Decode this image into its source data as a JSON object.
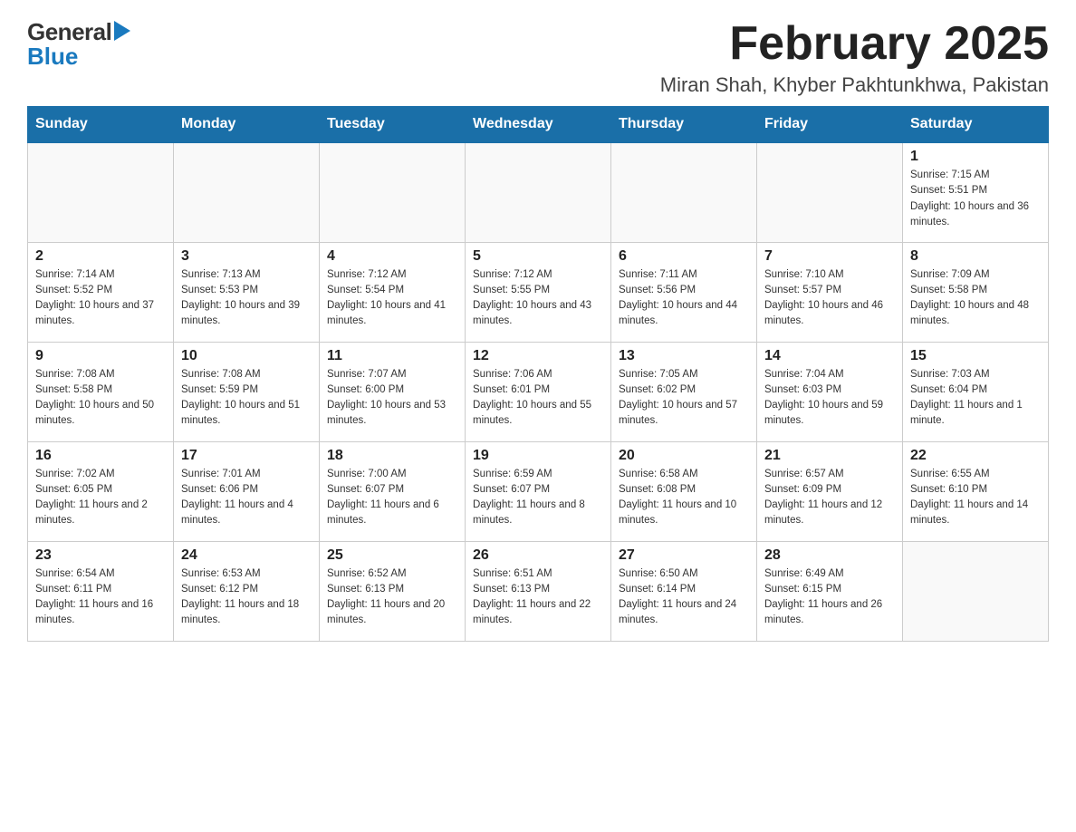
{
  "header": {
    "logo_general": "General",
    "logo_blue": "Blue",
    "month_title": "February 2025",
    "subtitle": "Miran Shah, Khyber Pakhtunkhwa, Pakistan"
  },
  "days_of_week": [
    "Sunday",
    "Monday",
    "Tuesday",
    "Wednesday",
    "Thursday",
    "Friday",
    "Saturday"
  ],
  "weeks": [
    [
      {
        "day": "",
        "sunrise": "",
        "sunset": "",
        "daylight": ""
      },
      {
        "day": "",
        "sunrise": "",
        "sunset": "",
        "daylight": ""
      },
      {
        "day": "",
        "sunrise": "",
        "sunset": "",
        "daylight": ""
      },
      {
        "day": "",
        "sunrise": "",
        "sunset": "",
        "daylight": ""
      },
      {
        "day": "",
        "sunrise": "",
        "sunset": "",
        "daylight": ""
      },
      {
        "day": "",
        "sunrise": "",
        "sunset": "",
        "daylight": ""
      },
      {
        "day": "1",
        "sunrise": "Sunrise: 7:15 AM",
        "sunset": "Sunset: 5:51 PM",
        "daylight": "Daylight: 10 hours and 36 minutes."
      }
    ],
    [
      {
        "day": "2",
        "sunrise": "Sunrise: 7:14 AM",
        "sunset": "Sunset: 5:52 PM",
        "daylight": "Daylight: 10 hours and 37 minutes."
      },
      {
        "day": "3",
        "sunrise": "Sunrise: 7:13 AM",
        "sunset": "Sunset: 5:53 PM",
        "daylight": "Daylight: 10 hours and 39 minutes."
      },
      {
        "day": "4",
        "sunrise": "Sunrise: 7:12 AM",
        "sunset": "Sunset: 5:54 PM",
        "daylight": "Daylight: 10 hours and 41 minutes."
      },
      {
        "day": "5",
        "sunrise": "Sunrise: 7:12 AM",
        "sunset": "Sunset: 5:55 PM",
        "daylight": "Daylight: 10 hours and 43 minutes."
      },
      {
        "day": "6",
        "sunrise": "Sunrise: 7:11 AM",
        "sunset": "Sunset: 5:56 PM",
        "daylight": "Daylight: 10 hours and 44 minutes."
      },
      {
        "day": "7",
        "sunrise": "Sunrise: 7:10 AM",
        "sunset": "Sunset: 5:57 PM",
        "daylight": "Daylight: 10 hours and 46 minutes."
      },
      {
        "day": "8",
        "sunrise": "Sunrise: 7:09 AM",
        "sunset": "Sunset: 5:58 PM",
        "daylight": "Daylight: 10 hours and 48 minutes."
      }
    ],
    [
      {
        "day": "9",
        "sunrise": "Sunrise: 7:08 AM",
        "sunset": "Sunset: 5:58 PM",
        "daylight": "Daylight: 10 hours and 50 minutes."
      },
      {
        "day": "10",
        "sunrise": "Sunrise: 7:08 AM",
        "sunset": "Sunset: 5:59 PM",
        "daylight": "Daylight: 10 hours and 51 minutes."
      },
      {
        "day": "11",
        "sunrise": "Sunrise: 7:07 AM",
        "sunset": "Sunset: 6:00 PM",
        "daylight": "Daylight: 10 hours and 53 minutes."
      },
      {
        "day": "12",
        "sunrise": "Sunrise: 7:06 AM",
        "sunset": "Sunset: 6:01 PM",
        "daylight": "Daylight: 10 hours and 55 minutes."
      },
      {
        "day": "13",
        "sunrise": "Sunrise: 7:05 AM",
        "sunset": "Sunset: 6:02 PM",
        "daylight": "Daylight: 10 hours and 57 minutes."
      },
      {
        "day": "14",
        "sunrise": "Sunrise: 7:04 AM",
        "sunset": "Sunset: 6:03 PM",
        "daylight": "Daylight: 10 hours and 59 minutes."
      },
      {
        "day": "15",
        "sunrise": "Sunrise: 7:03 AM",
        "sunset": "Sunset: 6:04 PM",
        "daylight": "Daylight: 11 hours and 1 minute."
      }
    ],
    [
      {
        "day": "16",
        "sunrise": "Sunrise: 7:02 AM",
        "sunset": "Sunset: 6:05 PM",
        "daylight": "Daylight: 11 hours and 2 minutes."
      },
      {
        "day": "17",
        "sunrise": "Sunrise: 7:01 AM",
        "sunset": "Sunset: 6:06 PM",
        "daylight": "Daylight: 11 hours and 4 minutes."
      },
      {
        "day": "18",
        "sunrise": "Sunrise: 7:00 AM",
        "sunset": "Sunset: 6:07 PM",
        "daylight": "Daylight: 11 hours and 6 minutes."
      },
      {
        "day": "19",
        "sunrise": "Sunrise: 6:59 AM",
        "sunset": "Sunset: 6:07 PM",
        "daylight": "Daylight: 11 hours and 8 minutes."
      },
      {
        "day": "20",
        "sunrise": "Sunrise: 6:58 AM",
        "sunset": "Sunset: 6:08 PM",
        "daylight": "Daylight: 11 hours and 10 minutes."
      },
      {
        "day": "21",
        "sunrise": "Sunrise: 6:57 AM",
        "sunset": "Sunset: 6:09 PM",
        "daylight": "Daylight: 11 hours and 12 minutes."
      },
      {
        "day": "22",
        "sunrise": "Sunrise: 6:55 AM",
        "sunset": "Sunset: 6:10 PM",
        "daylight": "Daylight: 11 hours and 14 minutes."
      }
    ],
    [
      {
        "day": "23",
        "sunrise": "Sunrise: 6:54 AM",
        "sunset": "Sunset: 6:11 PM",
        "daylight": "Daylight: 11 hours and 16 minutes."
      },
      {
        "day": "24",
        "sunrise": "Sunrise: 6:53 AM",
        "sunset": "Sunset: 6:12 PM",
        "daylight": "Daylight: 11 hours and 18 minutes."
      },
      {
        "day": "25",
        "sunrise": "Sunrise: 6:52 AM",
        "sunset": "Sunset: 6:13 PM",
        "daylight": "Daylight: 11 hours and 20 minutes."
      },
      {
        "day": "26",
        "sunrise": "Sunrise: 6:51 AM",
        "sunset": "Sunset: 6:13 PM",
        "daylight": "Daylight: 11 hours and 22 minutes."
      },
      {
        "day": "27",
        "sunrise": "Sunrise: 6:50 AM",
        "sunset": "Sunset: 6:14 PM",
        "daylight": "Daylight: 11 hours and 24 minutes."
      },
      {
        "day": "28",
        "sunrise": "Sunrise: 6:49 AM",
        "sunset": "Sunset: 6:15 PM",
        "daylight": "Daylight: 11 hours and 26 minutes."
      },
      {
        "day": "",
        "sunrise": "",
        "sunset": "",
        "daylight": ""
      }
    ]
  ]
}
